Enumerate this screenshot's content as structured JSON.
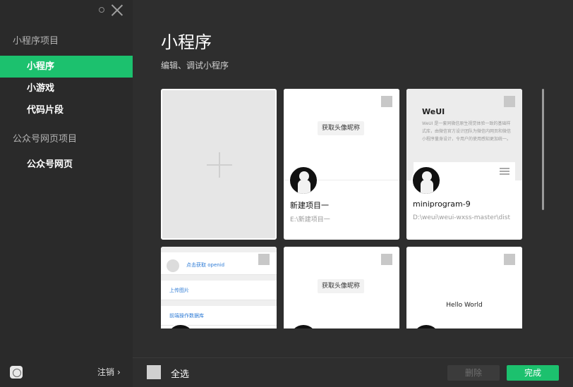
{
  "sidebar": {
    "sections": [
      {
        "title": "小程序项目",
        "items": [
          "小程序",
          "小游戏",
          "代码片段"
        ]
      },
      {
        "title": "公众号网页项目",
        "items": [
          "公众号网页"
        ]
      }
    ],
    "logout": "注销",
    "logout_chevron": "›"
  },
  "main": {
    "title": "小程序",
    "subtitle": "编辑、调试小程序",
    "cards": [
      {
        "kind": "new"
      },
      {
        "preview_button": "获取头像昵称",
        "name": "新建项目一",
        "path": "E:\\新建项目一"
      },
      {
        "preview_title": "WeUI",
        "preview_desc": "WeUI 是一套同微信原生视觉体验一致的基础样式库，由微信官方设计团队为微信内网页和微信小程序量身设计，令用户的使用感知更加统一。",
        "name": "miniprogram-9",
        "path": "D:\\weui\\weui-wxss-master\\dist"
      },
      {
        "rows": [
          "点击获取 openid",
          "上传图片",
          "前端操作数据库"
        ]
      },
      {
        "preview_button": "获取头像昵称"
      },
      {
        "preview_text": "Hello World"
      }
    ]
  },
  "footer": {
    "select_all": "全选",
    "delete": "删除",
    "done": "完成"
  },
  "colors": {
    "accent": "#1cc16e",
    "sidebar_bg": "#2a2a2a",
    "main_bg": "#2e2e2e"
  }
}
